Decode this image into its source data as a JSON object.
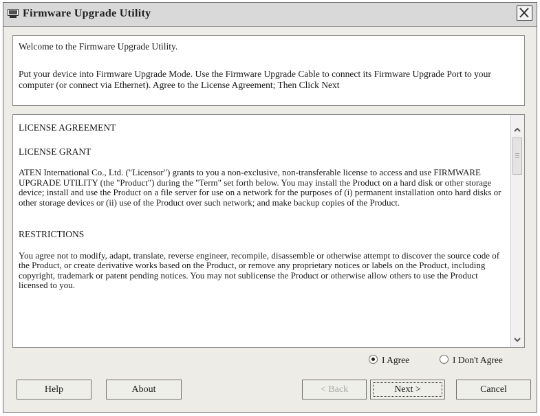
{
  "window": {
    "title": "Firmware Upgrade Utility"
  },
  "info": {
    "line1": "Welcome to the Firmware Upgrade Utility.",
    "line2": "Put your device into Firmware Upgrade Mode. Use the Firmware Upgrade Cable to connect its Firmware Upgrade Port to your computer (or connect via Ethernet). Agree to the License Agreement; Then Click Next"
  },
  "license": {
    "heading": "LICENSE AGREEMENT",
    "grant_heading": "LICENSE GRANT",
    "grant_text": "ATEN International Co., Ltd. (\"Licensor\") grants to you a non-exclusive, non-transferable license to access and use FIRMWARE UPGRADE UTILITY (the \"Product\") during the \"Term\" set forth below. You may install the Product on a hard disk or other storage device; install and use the Product on a file server for use on a network for the purposes of (i) permanent installation onto hard disks or other storage devices or (ii) use of the Product over such network; and make backup copies of the Product.",
    "restrictions_heading": "RESTRICTIONS",
    "restrictions_text": "You agree not to modify, adapt, translate, reverse engineer, recompile, disassemble or otherwise attempt to discover the source code of the Product, or create derivative works based on the Product, or remove any proprietary notices or labels on the Product, including copyright, trademark or patent pending notices. You may not sublicense the Product or otherwise allow others to use the Product licensed to you."
  },
  "agreement": {
    "agree_label": "I Agree",
    "disagree_label": "I Don't Agree",
    "selected": "agree"
  },
  "buttons": {
    "help": "Help",
    "about": "About",
    "back": "< Back",
    "next": "Next >",
    "cancel": "Cancel"
  }
}
